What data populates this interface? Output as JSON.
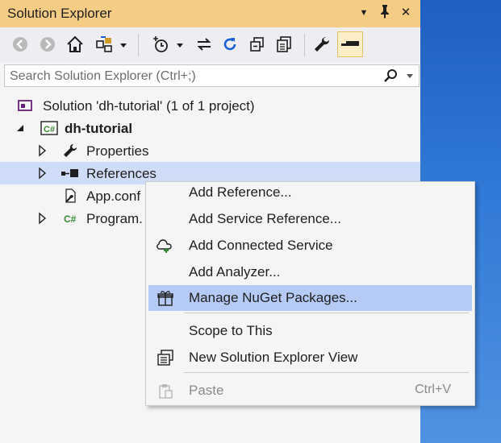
{
  "window": {
    "title": "Solution Explorer"
  },
  "titlebar": {
    "dropdown_glyph": "▼",
    "pin_glyph": "📌",
    "close_glyph": "✕"
  },
  "colors": {
    "titlebar_bg": "#f5cc84",
    "selection": "#cfdcf7",
    "menu_highlight": "#b5cbf5",
    "csharp_green": "#388a34"
  },
  "toolbar": {
    "icons": [
      "back-icon",
      "forward-icon",
      "home-icon",
      "switch-views-icon",
      "dropdown-icon",
      "pending-changes-icon",
      "dropdown-icon",
      "sync-icon",
      "refresh-icon",
      "collapse-all-icon",
      "show-all-files-icon",
      "properties-icon",
      "preview-icon"
    ]
  },
  "search": {
    "placeholder": "Search Solution Explorer (Ctrl+;)",
    "value": ""
  },
  "tree": {
    "solution": "Solution 'dh-tutorial' (1 of 1 project)",
    "project": "dh-tutorial",
    "properties": "Properties",
    "references": "References",
    "appconfig": "App.conf",
    "program": "Program."
  },
  "context_menu": {
    "items": [
      {
        "label": "Add Reference...",
        "icon": ""
      },
      {
        "label": "Add Service Reference...",
        "icon": ""
      },
      {
        "label": "Add Connected Service",
        "icon": "connected-service-icon"
      },
      {
        "label": "Add Analyzer...",
        "icon": ""
      },
      {
        "label": "Manage NuGet Packages...",
        "icon": "nuget-gift-icon"
      },
      {
        "label": "Scope to This",
        "icon": ""
      },
      {
        "label": "New Solution Explorer View",
        "icon": "new-view-icon"
      },
      {
        "label": "Paste",
        "shortcut": "Ctrl+V",
        "icon": "paste-icon",
        "disabled": true
      }
    ]
  }
}
